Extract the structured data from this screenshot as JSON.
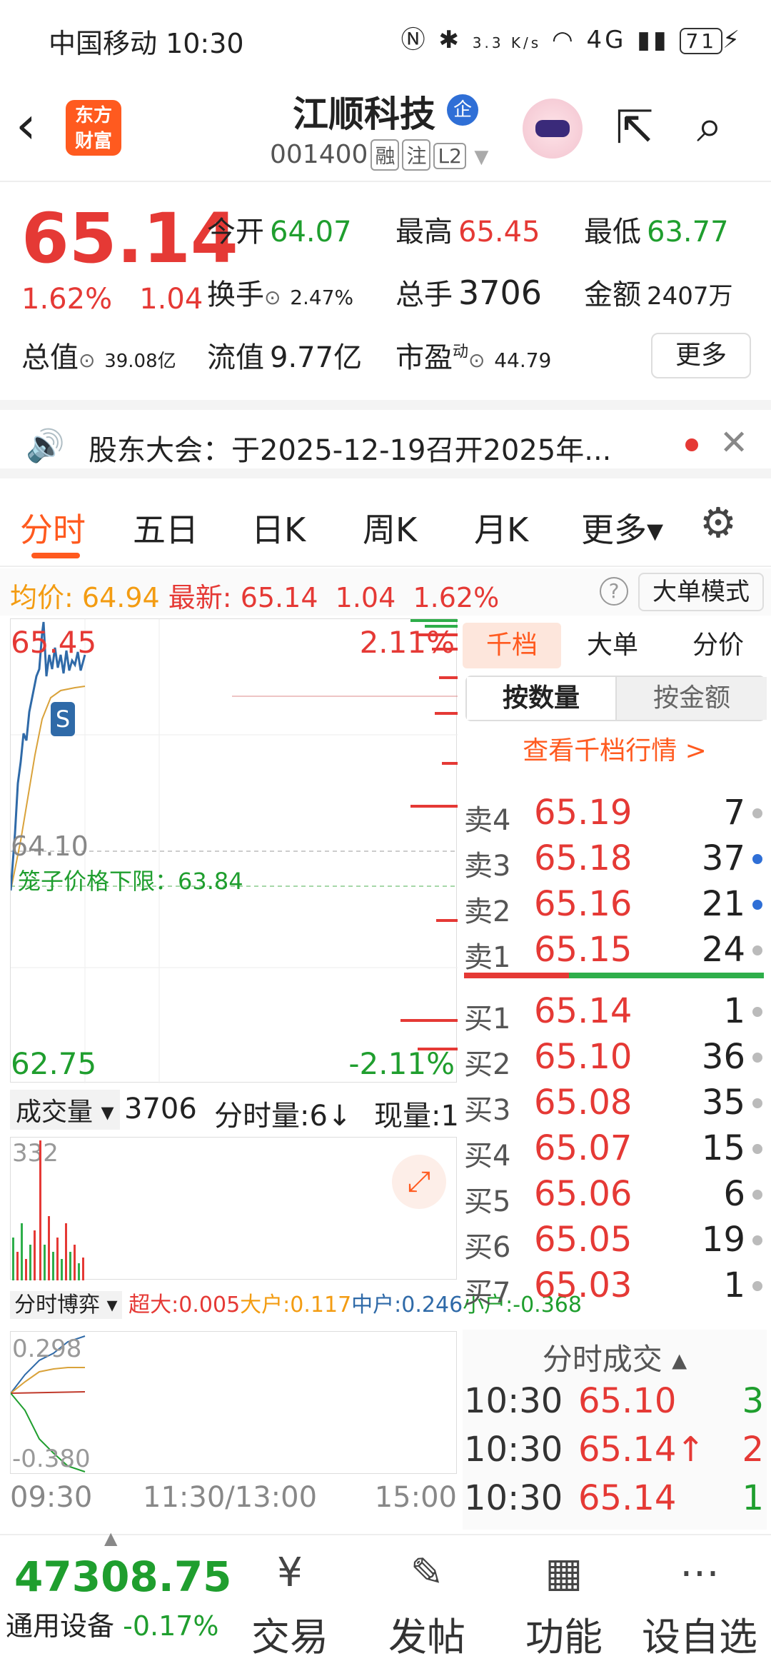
{
  "status": {
    "carrier": "中国移动 10:30",
    "speed": "3.3 K/s",
    "battery": "71"
  },
  "nav": {
    "logo_line1": "东方",
    "logo_line2": "财富",
    "name": "江顺科技",
    "badge": "企",
    "code": "001400",
    "tags": [
      "融",
      "注",
      "L2"
    ]
  },
  "quote": {
    "price": "65.14",
    "change_pct": "1.62%",
    "change": "1.04",
    "open_label": "今开",
    "open": "64.07",
    "high_label": "最高",
    "high": "65.45",
    "low_label": "最低",
    "low": "63.77",
    "turnover_label": "换手",
    "turnover": "2.47%",
    "volume_label": "总手",
    "volume": "3706",
    "amount_label": "金额",
    "amount": "2407万",
    "cap_label": "总值",
    "cap": "39.08亿",
    "float_label": "流值",
    "float": "9.77亿",
    "pe_label": "市盈",
    "pe_sup": "动",
    "pe": "44.79",
    "more": "更多"
  },
  "notice": {
    "text": "股东大会：于2025-12-19召开2025年..."
  },
  "tabs": [
    "分时",
    "五日",
    "日K",
    "周K",
    "月K",
    "更多▾"
  ],
  "avgbar": {
    "avg_label": "均价:",
    "avg": "64.94",
    "last_label": "最新:",
    "last": "65.14",
    "chg": "1.04",
    "pct": "1.62%",
    "q": "?",
    "mode": "大单模式"
  },
  "chart": {
    "high": "65.45",
    "high_pct": "2.11%",
    "mid": "64.10",
    "low": "62.75",
    "low_pct": "-2.11%",
    "cage": "笼子价格下限：",
    "cage_val": "63.84",
    "s": "S"
  },
  "vol": {
    "select": "成交量 ▾",
    "total": "3706",
    "per_label": "分时量:6↓",
    "now_label": "现量:1",
    "max": "332"
  },
  "game": {
    "select": "分时博弈 ▾",
    "super_label": "超大:",
    "super": "0.005",
    "big_label": "大户:",
    "big": "0.117",
    "mid_label": "中户:",
    "mid": "0.246",
    "small_label": "小户:",
    "small": "-0.368",
    "top": "0.298",
    "bottom": "-0.380"
  },
  "times": [
    "09:30",
    "11:30/13:00",
    "15:00"
  ],
  "book": {
    "tabs": [
      "千档",
      "大单",
      "分价"
    ],
    "seg": [
      "按数量",
      "按金额"
    ],
    "look": "查看千档行情 >",
    "sells": [
      {
        "k": "卖4",
        "p": "65.19",
        "n": "7",
        "dot": "gray"
      },
      {
        "k": "卖3",
        "p": "65.18",
        "n": "37",
        "dot": "blue"
      },
      {
        "k": "卖2",
        "p": "65.16",
        "n": "21",
        "dot": "blue"
      },
      {
        "k": "卖1",
        "p": "65.15",
        "n": "24",
        "dot": "gray"
      }
    ],
    "buys": [
      {
        "k": "买1",
        "p": "65.14",
        "n": "1"
      },
      {
        "k": "买2",
        "p": "65.10",
        "n": "36"
      },
      {
        "k": "买3",
        "p": "65.08",
        "n": "35"
      },
      {
        "k": "买4",
        "p": "65.07",
        "n": "15"
      },
      {
        "k": "买5",
        "p": "65.06",
        "n": "6"
      },
      {
        "k": "买6",
        "p": "65.05",
        "n": "19"
      },
      {
        "k": "买7",
        "p": "65.03",
        "n": "1"
      }
    ]
  },
  "trades": {
    "title": "分时成交 ▴",
    "rows": [
      {
        "t": "10:30",
        "p": "65.10",
        "v": "3",
        "c": "green"
      },
      {
        "t": "10:30",
        "p": "65.14↑",
        "v": "2",
        "c": "red"
      },
      {
        "t": "10:30",
        "p": "65.14",
        "v": "1",
        "c": "green"
      }
    ]
  },
  "bottom": {
    "index": "47308.75",
    "index_name": "通用设备",
    "index_pct": "-0.17%",
    "buttons": [
      {
        "icon": "yen-icon",
        "glyph": "¥",
        "label": "交易"
      },
      {
        "icon": "edit-icon",
        "glyph": "✎",
        "label": "发帖"
      },
      {
        "icon": "grid-icon",
        "glyph": "▦",
        "label": "功能"
      },
      {
        "icon": "more-icon",
        "glyph": "⋯",
        "label": "设自选"
      }
    ]
  }
}
